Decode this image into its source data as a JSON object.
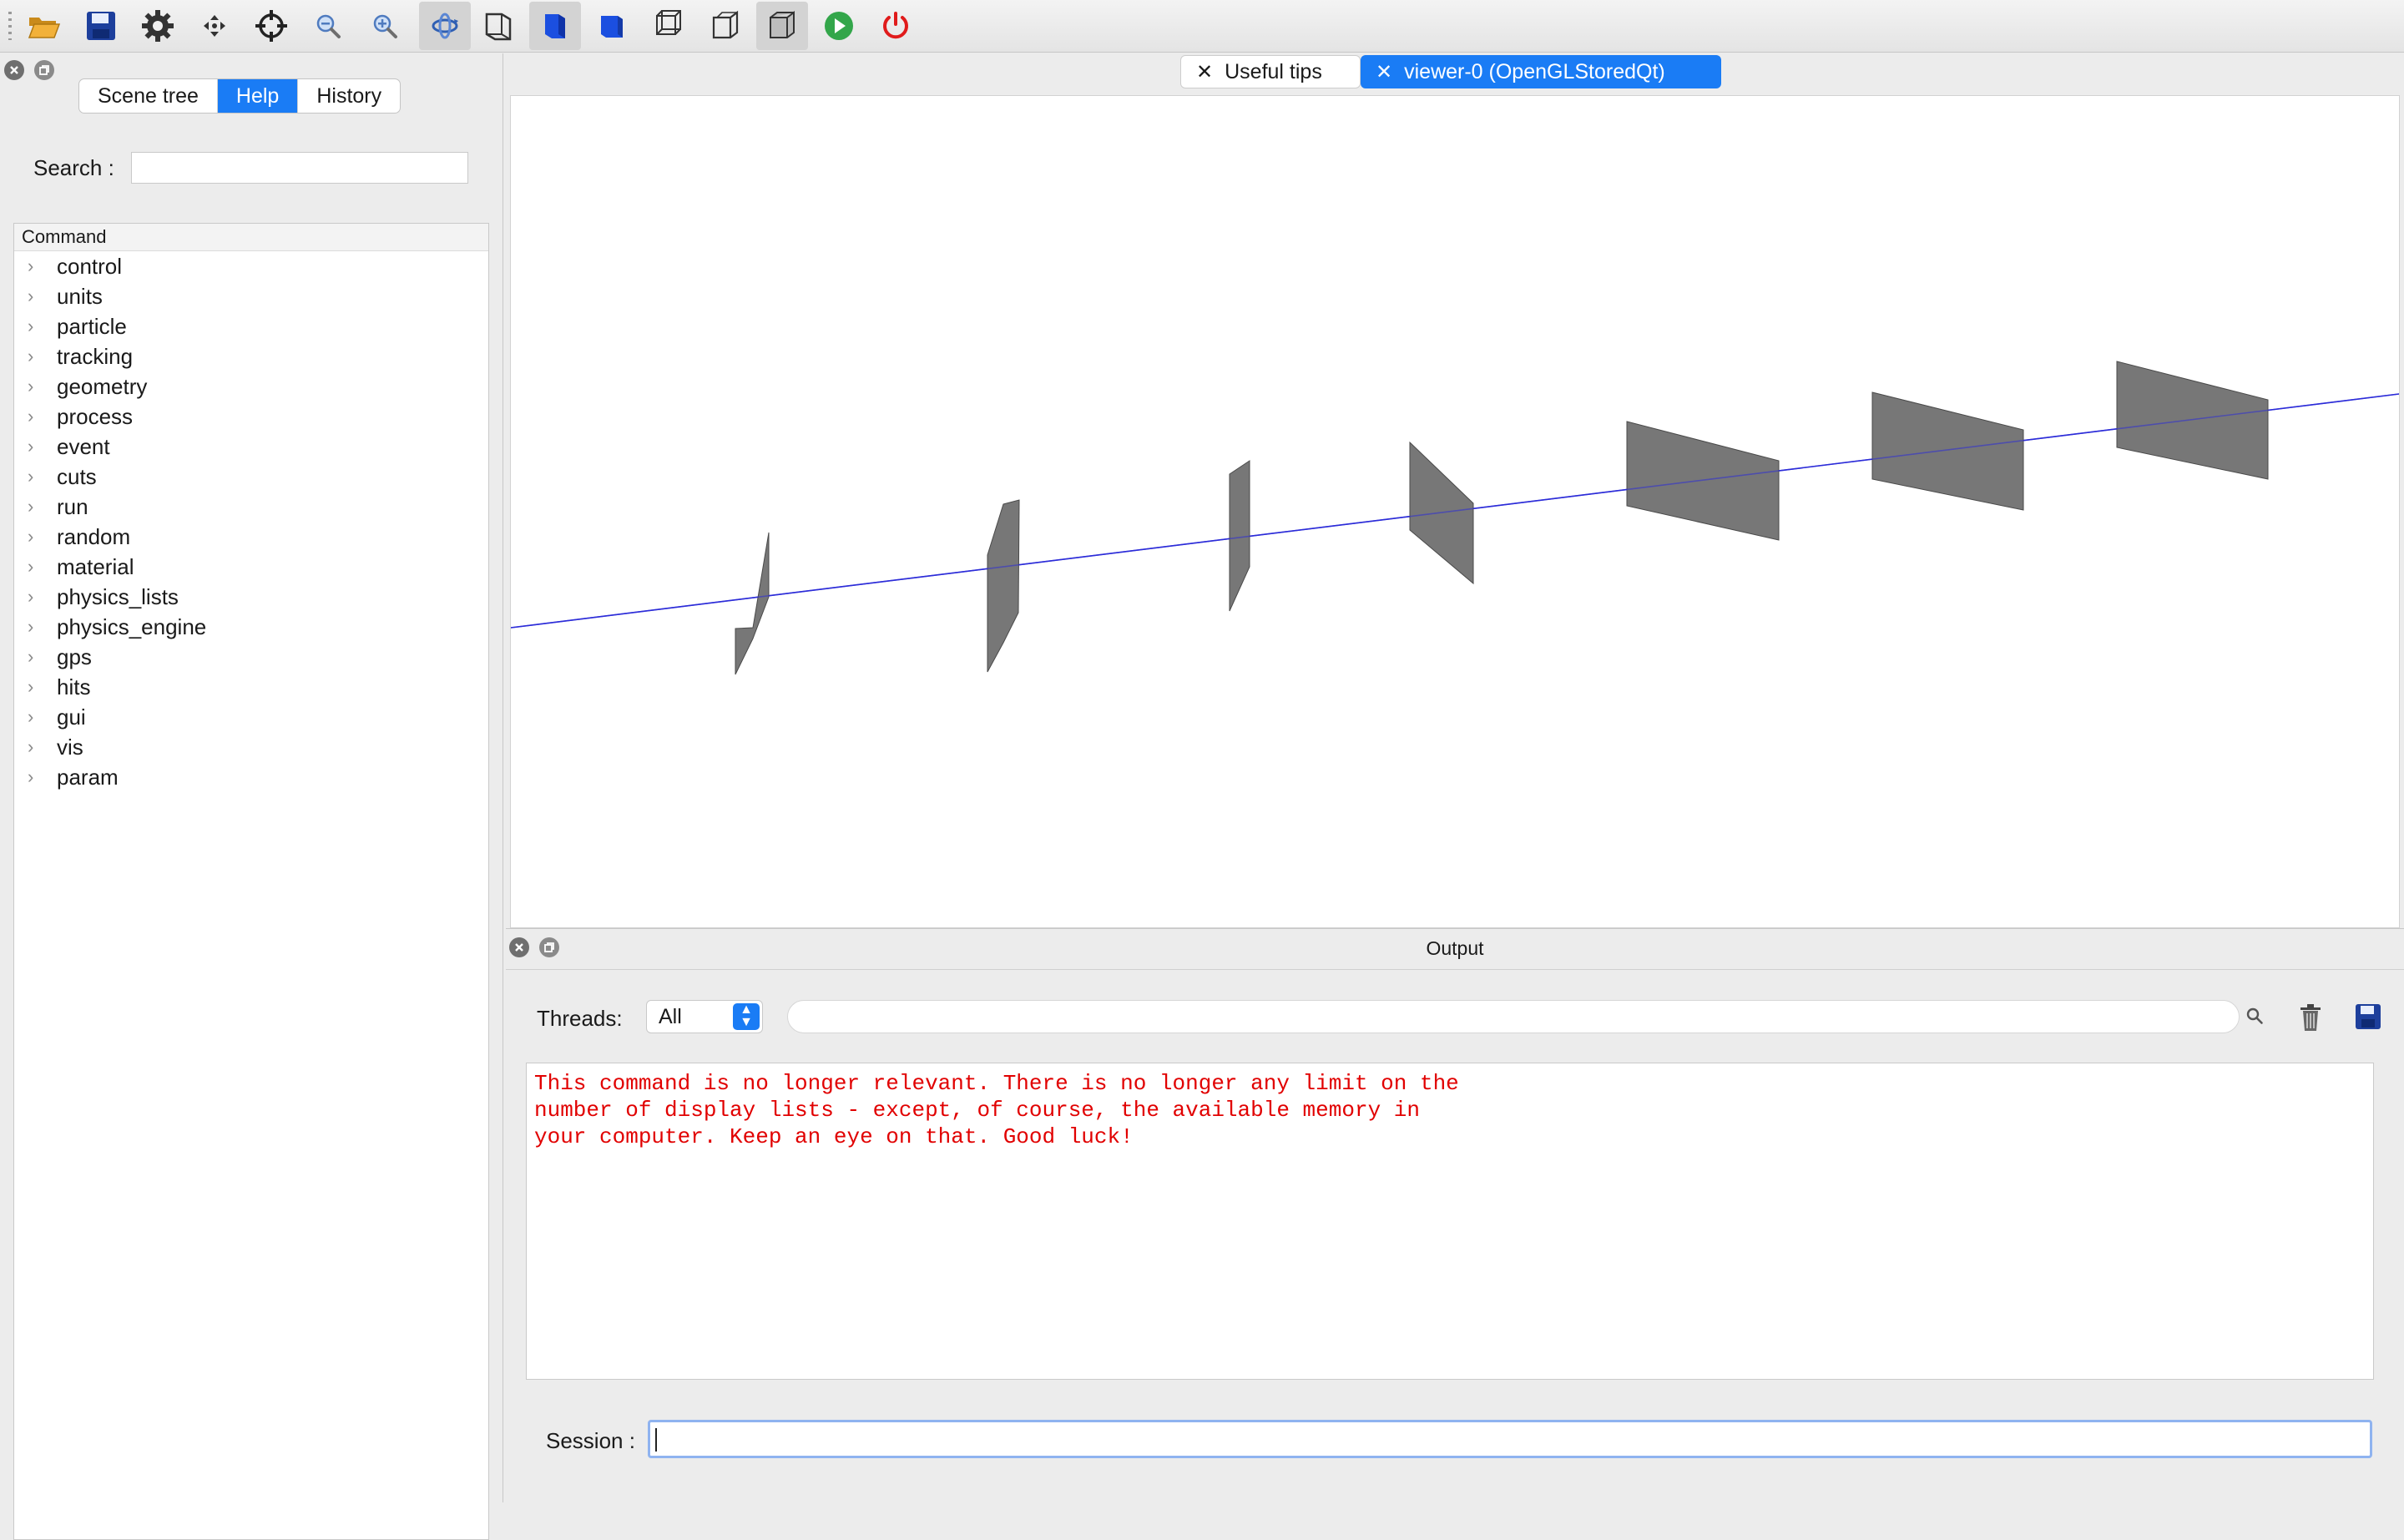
{
  "toolbar": {
    "buttons": [
      {
        "name": "open-icon",
        "active": false
      },
      {
        "name": "save-icon",
        "active": false
      },
      {
        "name": "gear-icon",
        "active": false
      },
      {
        "name": "move-icon",
        "active": false
      },
      {
        "name": "pick-target-icon",
        "active": false
      },
      {
        "name": "zoom-out-icon",
        "active": false
      },
      {
        "name": "zoom-in-icon",
        "active": false
      },
      {
        "name": "rotate-icon",
        "active": true
      },
      {
        "name": "perspective-wireframe-icon",
        "active": false
      },
      {
        "name": "solid-cube-icon",
        "active": true
      },
      {
        "name": "ortho-solid-icon",
        "active": false
      },
      {
        "name": "wireframe-cube-icon",
        "active": false
      },
      {
        "name": "hidden-line-cube-icon",
        "active": false
      },
      {
        "name": "hidden-line-removal-icon",
        "active": true
      },
      {
        "name": "run-icon",
        "active": false
      },
      {
        "name": "power-icon",
        "active": false
      }
    ]
  },
  "left_dock": {
    "tabs": [
      {
        "label": "Scene tree",
        "selected": false
      },
      {
        "label": "Help",
        "selected": true
      },
      {
        "label": "History",
        "selected": false
      }
    ],
    "search_label": "Search :",
    "search_value": "",
    "tree_header": "Command",
    "commands": [
      "control",
      "units",
      "particle",
      "tracking",
      "geometry",
      "process",
      "event",
      "cuts",
      "run",
      "random",
      "material",
      "physics_lists",
      "physics_engine",
      "gps",
      "hits",
      "gui",
      "vis",
      "param"
    ]
  },
  "viewer": {
    "tabs": [
      {
        "label": "Useful tips",
        "selected": false
      },
      {
        "label": "viewer-0 (OpenGLStoredQt)",
        "selected": true
      }
    ],
    "colors": {
      "beam": "#2b2bd8",
      "plate_fill": "#777777",
      "plate_edge": "#4a4a4a"
    }
  },
  "output": {
    "title": "Output",
    "threads_label": "Threads:",
    "threads_value": "All",
    "filter_value": "",
    "lines": [
      "This command is no longer relevant. There is no longer any limit on the",
      "number of display lists - except, of course, the available memory in",
      "your computer. Keep an eye on that. Good luck!"
    ],
    "text_color": "#e10000",
    "session_label": "Session :",
    "session_value": ""
  }
}
